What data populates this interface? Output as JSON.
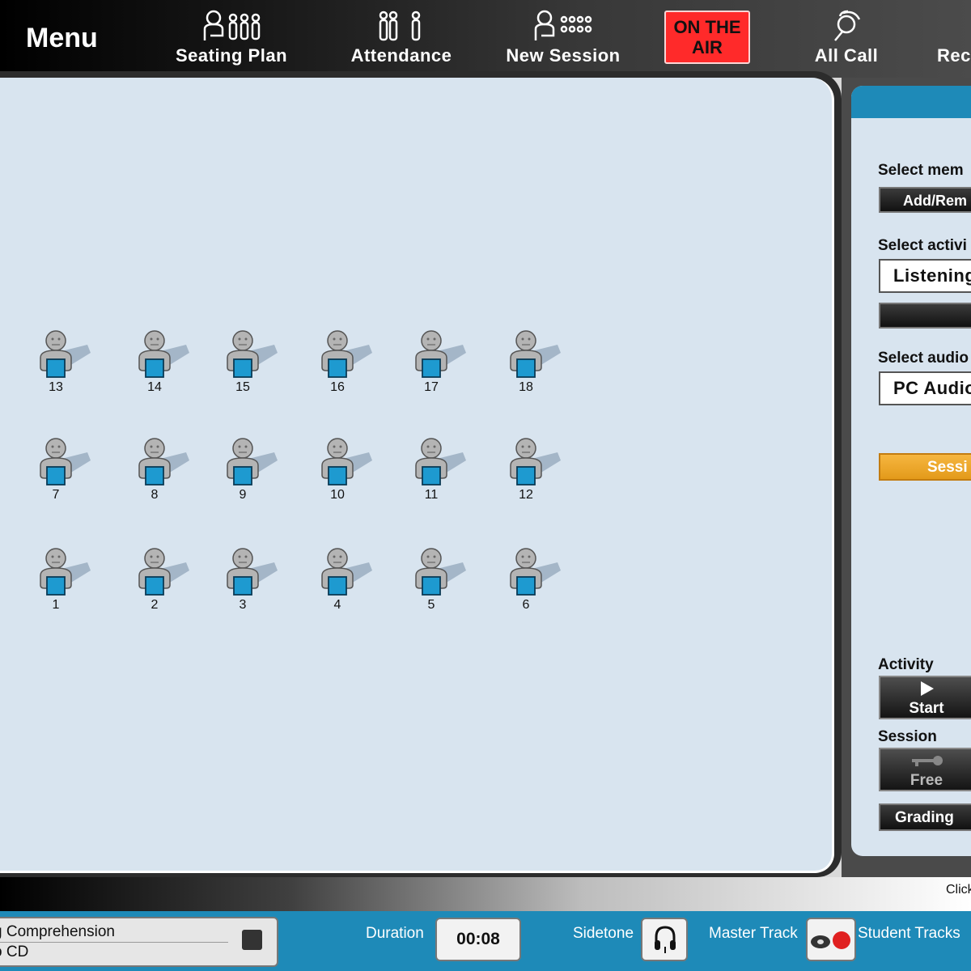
{
  "toolbar": {
    "menu_label": "Menu",
    "items": [
      {
        "label": "Seating Plan",
        "icon": "seating-plan-icon"
      },
      {
        "label": "Attendance",
        "icon": "attendance-icon"
      },
      {
        "label": "New Session",
        "icon": "new-session-icon"
      },
      {
        "label": "All Call",
        "icon": "all-call-icon"
      },
      {
        "label": "Rec",
        "icon": "record-icon"
      }
    ],
    "on_air": {
      "line1": "ON THE",
      "line2": "AIR",
      "color": "#ff2a2a"
    }
  },
  "classroom": {
    "seats": [
      "13",
      "14",
      "15",
      "16",
      "17",
      "18",
      "7",
      "8",
      "9",
      "10",
      "11",
      "12",
      "1",
      "2",
      "3",
      "4",
      "5",
      "6"
    ]
  },
  "panel": {
    "select_members_label": "Select mem",
    "add_remove_button": "Add/Rem",
    "select_activity_label": "Select activi",
    "activity_value": "Listening",
    "select_audio_label": "Select audio",
    "audio_value": "PC Audio",
    "session_button": "Sessi",
    "activity_heading": "Activity",
    "start_button": "Start",
    "session_heading": "Session",
    "free_button": "Free",
    "grading_button": "Grading"
  },
  "status": {
    "click_hint": "Click"
  },
  "bottom": {
    "track_line1": "g Comprehension",
    "track_line2": "o CD",
    "duration_label": "Duration",
    "duration_value": "00:08",
    "sidetone_label": "Sidetone",
    "master_track_label": "Master Track",
    "student_tracks_label": "Student Tracks"
  },
  "colors": {
    "accent_blue": "#1e8ab8",
    "session_orange": "#f0a830",
    "on_air_red": "#ff2a2a"
  }
}
